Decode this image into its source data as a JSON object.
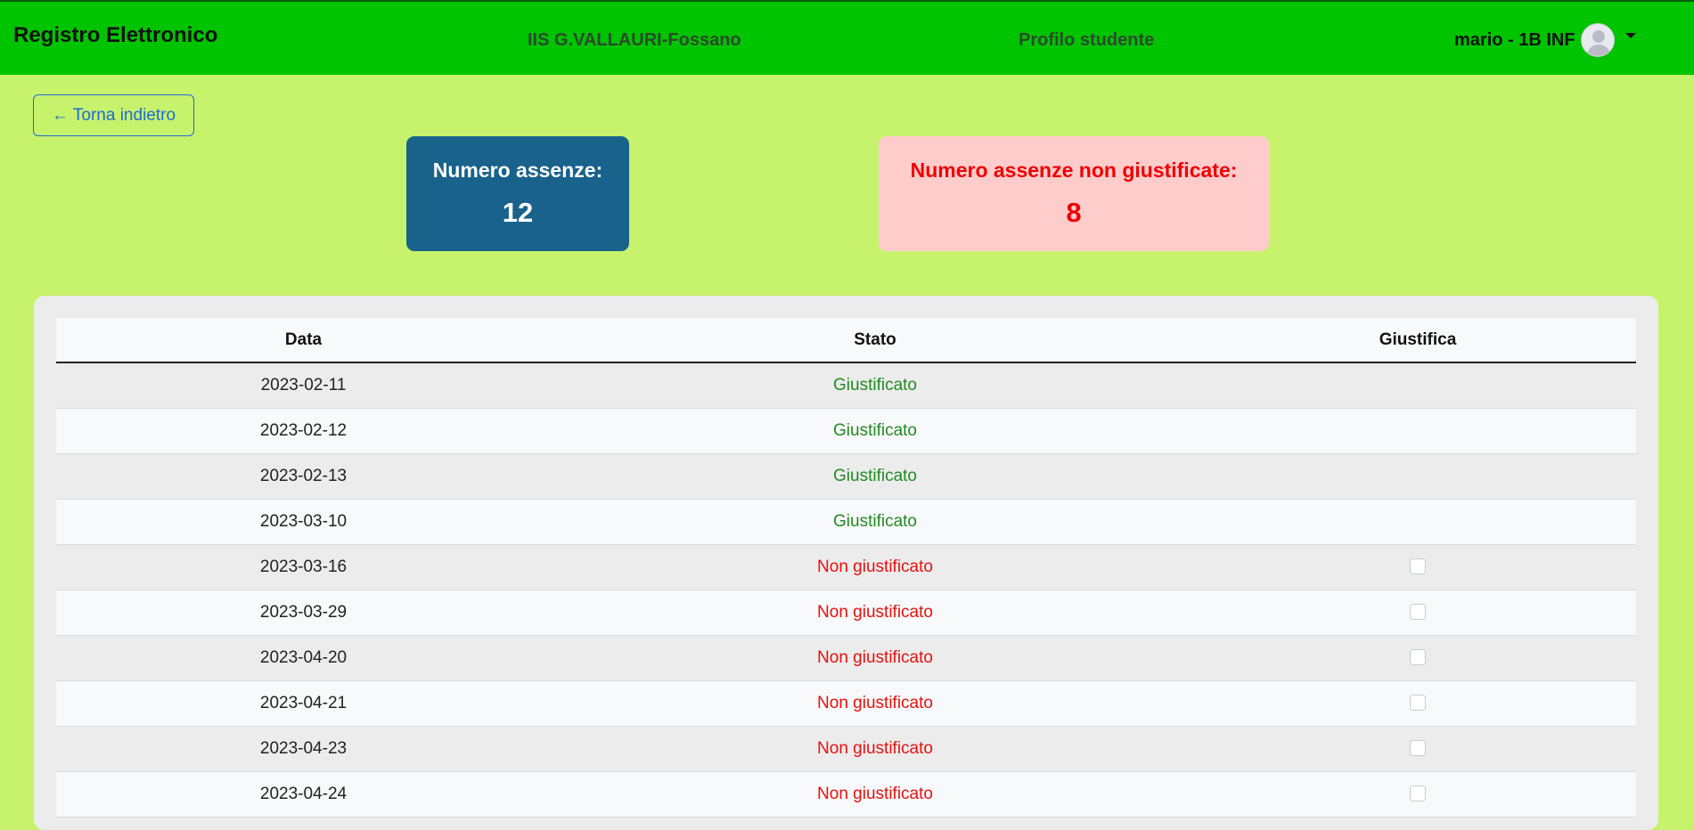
{
  "navbar": {
    "brand": "Registro Elettronico",
    "school": "IIS G.VALLAURI-Fossano",
    "profile": "Profilo studente",
    "user": "mario - 1B INF"
  },
  "back_button": {
    "label": "← Torna indietro"
  },
  "summary": {
    "total_label": "Numero assenze:",
    "total_value": "12",
    "unjustified_label": "Numero assenze non giustificate:",
    "unjustified_value": "8"
  },
  "table": {
    "headers": [
      "Data",
      "Stato",
      "Giustifica"
    ],
    "rows": [
      {
        "date": "2023-02-11",
        "status": "Giustificato",
        "justified": true
      },
      {
        "date": "2023-02-12",
        "status": "Giustificato",
        "justified": true
      },
      {
        "date": "2023-02-13",
        "status": "Giustificato",
        "justified": true
      },
      {
        "date": "2023-03-10",
        "status": "Giustificato",
        "justified": true
      },
      {
        "date": "2023-03-16",
        "status": "Non giustificato",
        "justified": false
      },
      {
        "date": "2023-03-29",
        "status": "Non giustificato",
        "justified": false
      },
      {
        "date": "2023-04-20",
        "status": "Non giustificato",
        "justified": false
      },
      {
        "date": "2023-04-21",
        "status": "Non giustificato",
        "justified": false
      },
      {
        "date": "2023-04-23",
        "status": "Non giustificato",
        "justified": false
      },
      {
        "date": "2023-04-24",
        "status": "Non giustificato",
        "justified": false
      }
    ]
  },
  "colors": {
    "navbar_bg": "#00c400",
    "page_bg": "#c7f26c",
    "total_card_bg": "#19628c",
    "unjustified_card_bg": "#ffcccc",
    "justified_text": "#238a23",
    "unjustified_text": "#e81010",
    "link_blue": "#1e6bd6"
  }
}
